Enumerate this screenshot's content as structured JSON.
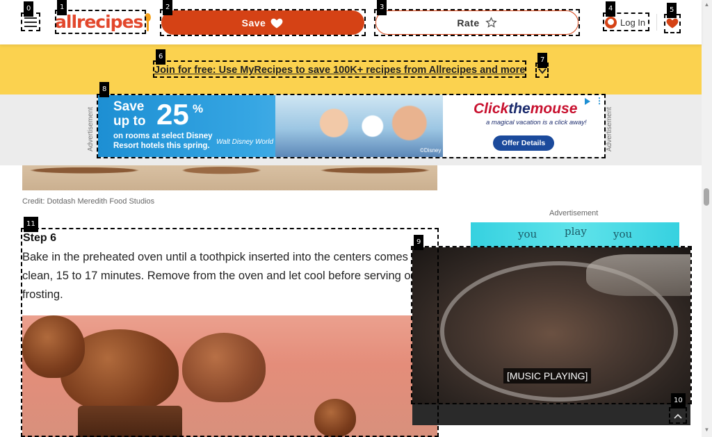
{
  "header": {
    "logo_text": "allrecipes",
    "save_label": "Save",
    "rate_label": "Rate",
    "login_label": "Log In"
  },
  "promo": {
    "link_text": "Join for free: Use MyRecipes to save 100K+ recipes from Allrecipes and more"
  },
  "ad_banner": {
    "side_label": "Advertisement",
    "headline": "Save\nup to",
    "percent": "25",
    "percent_sign": "%",
    "subtext": "on rooms at select Disney Resort hotels this spring.",
    "brand": "Walt Disney World",
    "fine_print": "©Disney",
    "right_brand_a": "Click",
    "right_brand_b": "the",
    "right_brand_c": "mouse",
    "right_tagline": "a magical vacation is a click away!",
    "offer_button": "Offer Details"
  },
  "content": {
    "credit": "Credit: Dotdash Meredith Food Studios",
    "step_title": "Step 6",
    "step_text": "Bake in the preheated oven until a toothpick inserted into the centers comes out clean, 15 to 17 minutes. Remove from the oven and let cool before serving or frosting."
  },
  "rail": {
    "ad_label": "Advertisement",
    "ad_words": [
      "you",
      "play",
      "you"
    ]
  },
  "video": {
    "caption": "[MUSIC PLAYING]"
  },
  "annotations": [
    "0",
    "1",
    "2",
    "3",
    "4",
    "5",
    "6",
    "7",
    "8",
    "9",
    "10",
    "11"
  ],
  "colors": {
    "accent": "#d54215",
    "promo_bg": "#fbd24f",
    "logo": "#e2472c"
  }
}
